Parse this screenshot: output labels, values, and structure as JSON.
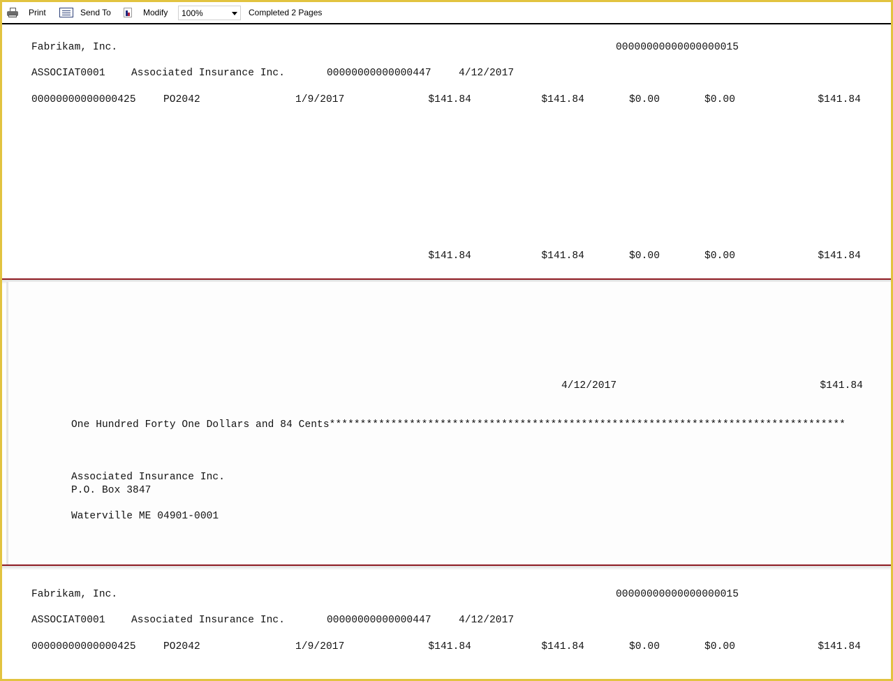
{
  "toolbar": {
    "print_label": "Print",
    "send_to_label": "Send To",
    "modify_label": "Modify",
    "zoom_value": "100%",
    "status_text": "Completed 2 Pages"
  },
  "stub_1": {
    "company": "Fabrikam, Inc.",
    "check_number": "00000000000000000015",
    "vendor_id": "ASSOCIAT0001",
    "vendor_name": "Associated Insurance Inc.",
    "document_number": "00000000000000447",
    "document_date": "4/12/2017",
    "lines": [
      {
        "voucher": "00000000000000425",
        "invoice": "PO2042",
        "date": "1/9/2017",
        "original_amount": "$141.84",
        "amount_paid": "$141.84",
        "discount": "$0.00",
        "writeoff": "$0.00",
        "net_paid": "$141.84"
      }
    ],
    "totals": {
      "original_amount": "$141.84",
      "amount_paid": "$141.84",
      "discount": "$0.00",
      "writeoff": "$0.00",
      "net_paid": "$141.84"
    }
  },
  "check": {
    "date": "4/12/2017",
    "amount": "$141.84",
    "amount_words": "One Hundred Forty One Dollars and 84 Cents************************************************************************************",
    "payee_name": "Associated Insurance Inc.",
    "address_line1": "P.O. Box 3847",
    "city_state_zip": "Waterville ME 04901-0001"
  },
  "stub_2": {
    "company": "Fabrikam, Inc.",
    "check_number": "00000000000000000015",
    "vendor_id": "ASSOCIAT0001",
    "vendor_name": "Associated Insurance Inc.",
    "document_number": "00000000000000447",
    "document_date": "4/12/2017",
    "lines": [
      {
        "voucher": "00000000000000425",
        "invoice": "PO2042",
        "date": "1/9/2017",
        "original_amount": "$141.84",
        "amount_paid": "$141.84",
        "discount": "$0.00",
        "writeoff": "$0.00",
        "net_paid": "$141.84"
      }
    ]
  }
}
